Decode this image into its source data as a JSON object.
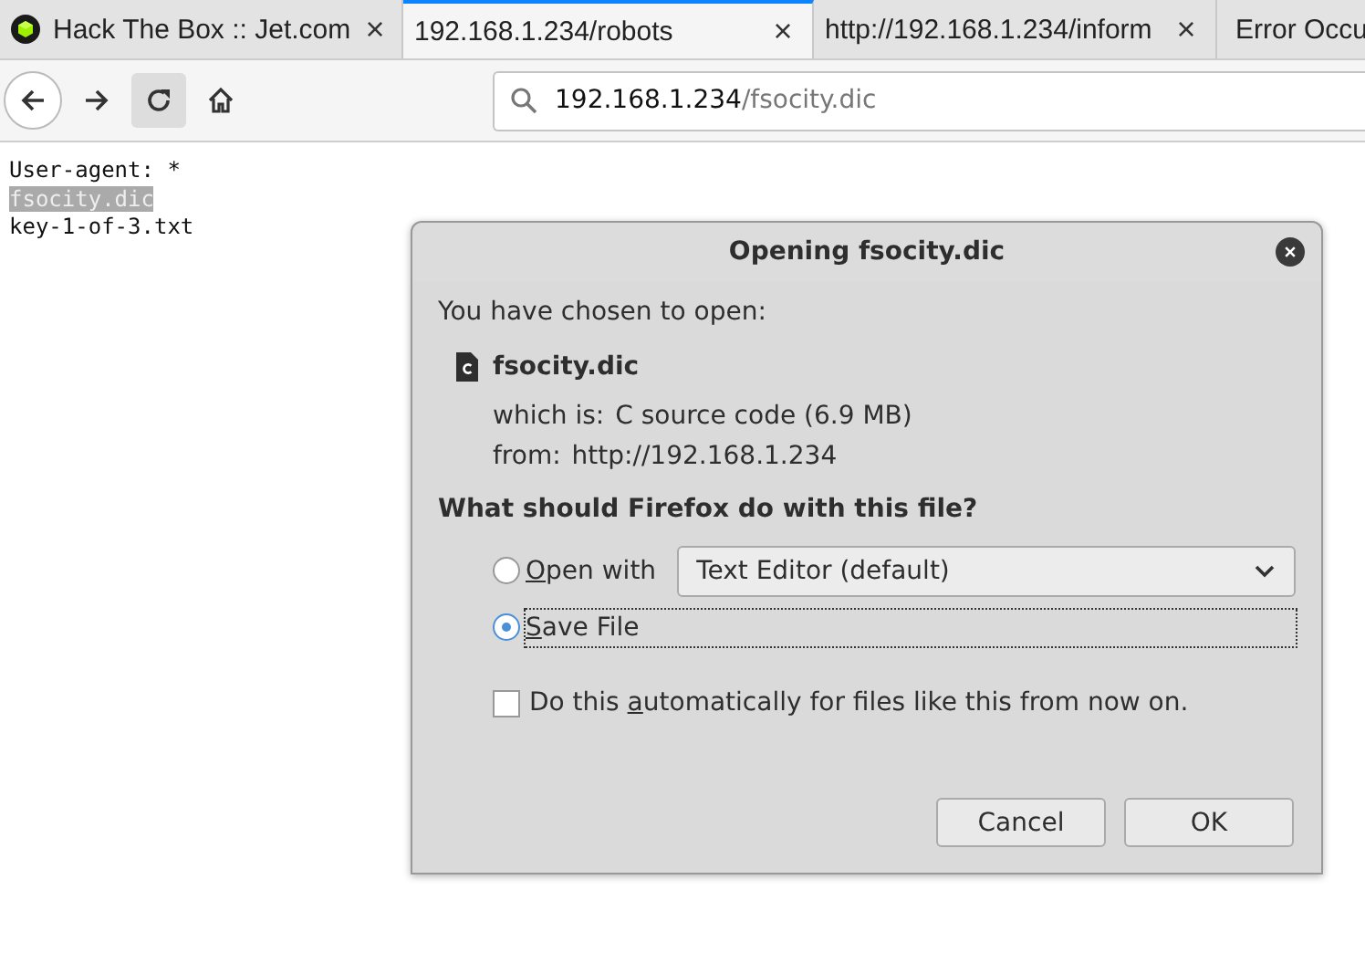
{
  "tabs": [
    {
      "title": "Hack The Box :: Jet.com",
      "selected": false,
      "favicon": true,
      "close": "×"
    },
    {
      "title": "192.168.1.234/robots",
      "selected": true,
      "favicon": false,
      "close": "×"
    },
    {
      "title": "http://192.168.1.234/inform",
      "selected": false,
      "favicon": false,
      "close": "×"
    },
    {
      "title": "Error Occu",
      "selected": false,
      "favicon": false
    }
  ],
  "url": {
    "host": "192.168.1.234",
    "path": "/fsocity.dic"
  },
  "page_lines": [
    {
      "text": "User-agent: *",
      "selected": false
    },
    {
      "text": "fsocity.dic",
      "selected": true
    },
    {
      "text": "key-1-of-3.txt",
      "selected": false
    }
  ],
  "dialog": {
    "title": "Opening fsocity.dic",
    "intro": "You have chosen to open:",
    "file_name": "fsocity.dic",
    "which_is_label": "which is:",
    "which_is": "C source code (6.9 MB)",
    "from_label": "from:",
    "from": "http://192.168.1.234",
    "question": "What should Firefox do with this file?",
    "options": [
      {
        "key": "O",
        "post": "pen with",
        "selected": false,
        "app": "Text Editor (default)"
      },
      {
        "key": "S",
        "post": "ave File",
        "selected": true
      }
    ],
    "auto": {
      "pre": "Do this ",
      "key": "a",
      "post": "utomatically for files like this from now on.",
      "checked": false
    },
    "buttons": [
      "Cancel",
      "OK"
    ]
  }
}
